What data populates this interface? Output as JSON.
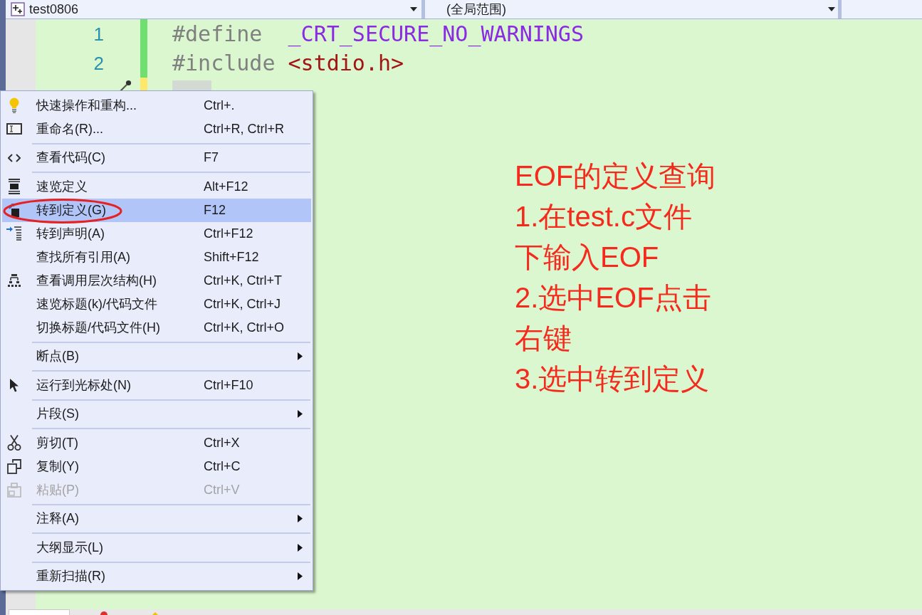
{
  "navigation_bar": {
    "project": "test0806",
    "scope": "(全局范围)"
  },
  "editor": {
    "lines": [
      {
        "number": "1",
        "saved": true,
        "action_marker": false,
        "selection": false,
        "tokens": [
          {
            "kind": "directive",
            "text": "#define  "
          },
          {
            "kind": "macro",
            "text": "_CRT_SECURE_NO_WARNINGS"
          }
        ]
      },
      {
        "number": "2",
        "saved": true,
        "action_marker": false,
        "selection": false,
        "tokens": [
          {
            "kind": "directive",
            "text": "#include "
          },
          {
            "kind": "header",
            "text": "<stdio.h>"
          }
        ]
      },
      {
        "saved": false,
        "action_marker": true,
        "selection": true
      }
    ]
  },
  "annotation": {
    "lines": [
      "EOF的定义查询",
      "1.在test.c文件",
      "下输入EOF",
      "2.选中EOF点击",
      "右键",
      "3.选中转到定义"
    ]
  },
  "context_menu": {
    "groups": [
      {
        "items": [
          {
            "label": "快速操作和重构...",
            "shortcut": "Ctrl+.",
            "selected": false,
            "disabled": false,
            "submenu": false
          },
          {
            "label": "重命名(R)...",
            "shortcut": "Ctrl+R, Ctrl+R",
            "selected": false,
            "disabled": false,
            "submenu": false
          }
        ]
      },
      {
        "items": [
          {
            "label": "查看代码(C)",
            "shortcut": "F7",
            "selected": false,
            "disabled": false,
            "submenu": false
          }
        ]
      },
      {
        "items": [
          {
            "label": "速览定义",
            "shortcut": "Alt+F12",
            "selected": false,
            "disabled": false,
            "submenu": false
          },
          {
            "label": "转到定义(G)",
            "shortcut": "F12",
            "selected": true,
            "disabled": false,
            "submenu": false
          },
          {
            "label": "转到声明(A)",
            "shortcut": "Ctrl+F12",
            "selected": false,
            "disabled": false,
            "submenu": false
          },
          {
            "label": "查找所有引用(A)",
            "shortcut": "Shift+F12",
            "selected": false,
            "disabled": false,
            "submenu": false
          },
          {
            "label": "查看调用层次结构(H)",
            "shortcut": "Ctrl+K, Ctrl+T",
            "selected": false,
            "disabled": false,
            "submenu": false
          },
          {
            "label": "速览标题(k)/代码文件",
            "shortcut": "Ctrl+K, Ctrl+J",
            "selected": false,
            "disabled": false,
            "submenu": false
          },
          {
            "label": "切换标题/代码文件(H)",
            "shortcut": "Ctrl+K, Ctrl+O",
            "selected": false,
            "disabled": false,
            "submenu": false
          }
        ]
      },
      {
        "items": [
          {
            "label": "断点(B)",
            "selected": false,
            "disabled": false,
            "submenu": true
          }
        ]
      },
      {
        "items": [
          {
            "label": "运行到光标处(N)",
            "shortcut": "Ctrl+F10",
            "selected": false,
            "disabled": false,
            "submenu": false
          }
        ]
      },
      {
        "items": [
          {
            "label": "片段(S)",
            "selected": false,
            "disabled": false,
            "submenu": true
          }
        ]
      },
      {
        "items": [
          {
            "label": "剪切(T)",
            "shortcut": "Ctrl+X",
            "selected": false,
            "disabled": false,
            "submenu": false
          },
          {
            "label": "复制(Y)",
            "shortcut": "Ctrl+C",
            "selected": false,
            "disabled": false,
            "submenu": false
          },
          {
            "label": "粘贴(P)",
            "shortcut": "Ctrl+V",
            "selected": false,
            "disabled": true,
            "submenu": false
          }
        ]
      },
      {
        "items": [
          {
            "label": "注释(A)",
            "selected": false,
            "disabled": false,
            "submenu": true
          }
        ]
      },
      {
        "items": [
          {
            "label": "大纲显示(L)",
            "selected": false,
            "disabled": false,
            "submenu": true
          }
        ]
      },
      {
        "items": [
          {
            "label": "重新扫描(R)",
            "selected": false,
            "disabled": false,
            "submenu": true
          }
        ]
      }
    ]
  }
}
